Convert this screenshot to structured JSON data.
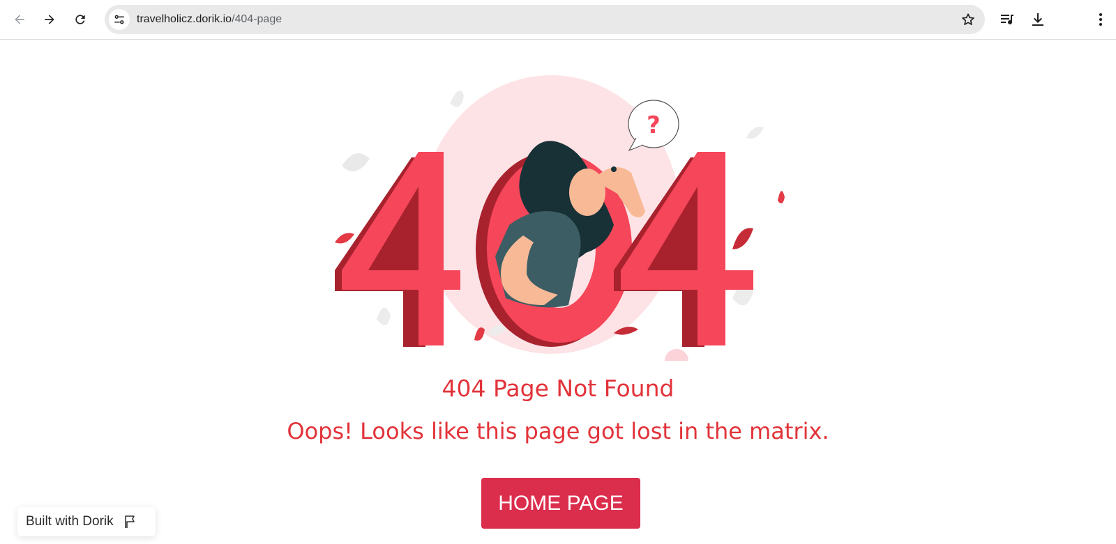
{
  "browser": {
    "url_host": "travelholicz.dorik.io",
    "url_path": "/404-page",
    "icons": {
      "back": "arrow-left-icon",
      "forward": "arrow-right-icon",
      "reload": "reload-icon",
      "site_info": "tune-icon",
      "bookmark": "star-icon",
      "media": "playlist-icon",
      "download": "download-icon",
      "menu": "kebab-menu-icon"
    }
  },
  "page": {
    "illustration_text": "404",
    "illustration_bubble": "?",
    "title": "404 Page Not Found",
    "subtitle": "Oops! Looks like this page got lost in the matrix.",
    "home_button": "HOME PAGE",
    "badge_label": "Built with Dorik"
  },
  "colors": {
    "accent": "#e2333a",
    "button": "#db2d4c",
    "digit_light": "#f5465a",
    "digit_dark": "#a8222e",
    "blush": "#fde3e6"
  }
}
